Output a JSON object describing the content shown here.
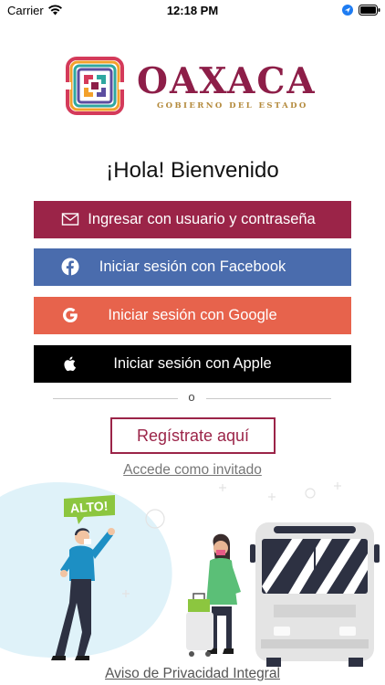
{
  "status_bar": {
    "carrier": "Carrier",
    "time": "12:18 PM",
    "icons": [
      "wifi-icon",
      "location-icon",
      "battery-icon"
    ]
  },
  "header": {
    "brand": "OAXACA",
    "subtitle": "GOBIERNO DEL ESTADO",
    "logo_icon": "oaxaca-emblem-icon"
  },
  "greeting": "¡Hola! Bienvenido",
  "login": {
    "user_label": "Ingresar con usuario y contraseña",
    "facebook_label": "Iniciar sesión con Facebook",
    "google_label": "Iniciar sesión con Google",
    "apple_label": "Iniciar sesión con Apple",
    "divider_text": "o",
    "register_label": "Regístrate aquí",
    "guest_label": "Accede como invitado"
  },
  "illustration": {
    "sign_text": "ALTO!"
  },
  "footer": {
    "privacy_label": "Aviso de Privacidad Integral"
  },
  "colors": {
    "brand": "#8d1e48",
    "user_button": "#9b2448",
    "facebook": "#4a6cad",
    "google": "#e7634c",
    "apple": "#000000",
    "gold": "#b48a3c",
    "illustration_bg": "#dff2f9"
  }
}
